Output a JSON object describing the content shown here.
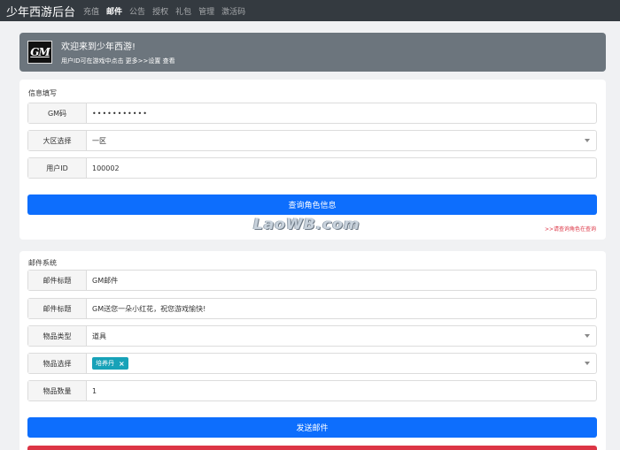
{
  "navbar": {
    "brand": "少年西游后台",
    "items": [
      {
        "label": "充值",
        "active": false
      },
      {
        "label": "邮件",
        "active": true
      },
      {
        "label": "公告",
        "active": false
      },
      {
        "label": "授权",
        "active": false
      },
      {
        "label": "礼包",
        "active": false
      },
      {
        "label": "管理",
        "active": false
      },
      {
        "label": "激活码",
        "active": false
      }
    ]
  },
  "banner": {
    "logo_text": "GM",
    "title": "欢迎来到少年西游!",
    "subtitle": "用户ID可在游戏中点击 更多>>设置 查看"
  },
  "info_section": {
    "title": "信息填写",
    "gm_code": {
      "label": "GM码",
      "value": "•••••••••••"
    },
    "region": {
      "label": "大区选择",
      "value": "一区"
    },
    "user_id": {
      "label": "用户ID",
      "value": "100002"
    },
    "query_button": "查询角色信息",
    "hint": ">>请查询角色在查询"
  },
  "watermark": "LaoWB.com",
  "mail_section": {
    "title": "邮件系统",
    "mail_title": {
      "label": "邮件标题",
      "value": "GM邮件"
    },
    "mail_content": {
      "label": "邮件标题",
      "value": "GM送您一朵小红花，祝您游戏愉快!"
    },
    "item_type": {
      "label": "物品类型",
      "value": "道具"
    },
    "item_select": {
      "label": "物品选择",
      "tag": "培养丹",
      "tag_remove": "×"
    },
    "item_qty": {
      "label": "物品数量",
      "value": "1"
    },
    "send_button": "发送邮件"
  },
  "colors": {
    "navbar": "#343a40",
    "banner": "#6c757d",
    "primary": "#0d6efd",
    "tag": "#17a2b8",
    "danger": "#dc3545"
  }
}
